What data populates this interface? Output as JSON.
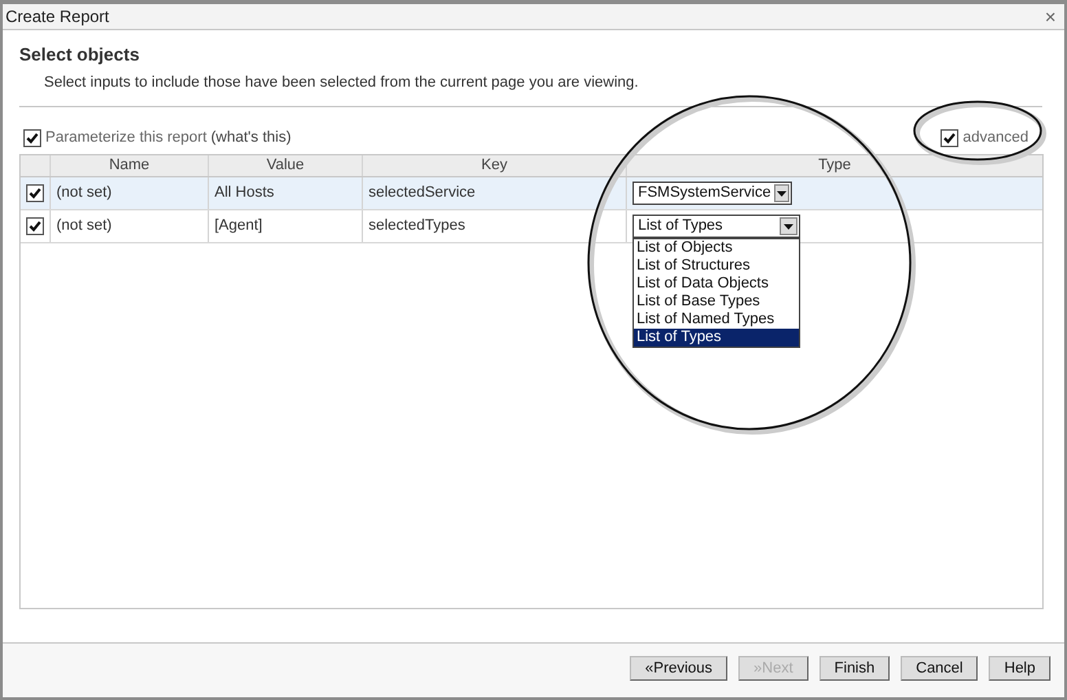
{
  "window": {
    "title": "Create Report",
    "close": "×"
  },
  "header": {
    "title": "Select objects",
    "subtitle": "Select inputs to include those have been selected from the current page you are viewing."
  },
  "parameterize": {
    "label": "Parameterize this report",
    "link": "(what's this)",
    "checked": true
  },
  "advanced": {
    "label": "advanced",
    "checked": true
  },
  "table": {
    "columns": [
      "Name",
      "Value",
      "Key",
      "Type"
    ],
    "rows": [
      {
        "checked": true,
        "selected": true,
        "name": "(not set)",
        "value": "All Hosts",
        "key": "selectedService",
        "type": "FSMSystemService"
      },
      {
        "checked": true,
        "selected": false,
        "name": "(not set)",
        "value": "[Agent]",
        "key": "selectedTypes",
        "type": "List of Types",
        "options": [
          {
            "label": "List of Objects",
            "selected": false
          },
          {
            "label": "List of Structures",
            "selected": false
          },
          {
            "label": "List of Data Objects",
            "selected": false
          },
          {
            "label": "List of Base Types",
            "selected": false
          },
          {
            "label": "List of Named Types",
            "selected": false
          },
          {
            "label": "List of Types",
            "selected": true
          }
        ]
      }
    ]
  },
  "buttons": [
    {
      "label": "«Previous",
      "disabled": false
    },
    {
      "label": "»Next",
      "disabled": true
    },
    {
      "label": "Finish",
      "disabled": false
    },
    {
      "label": "Cancel",
      "disabled": false
    },
    {
      "label": "Help",
      "disabled": false
    }
  ]
}
